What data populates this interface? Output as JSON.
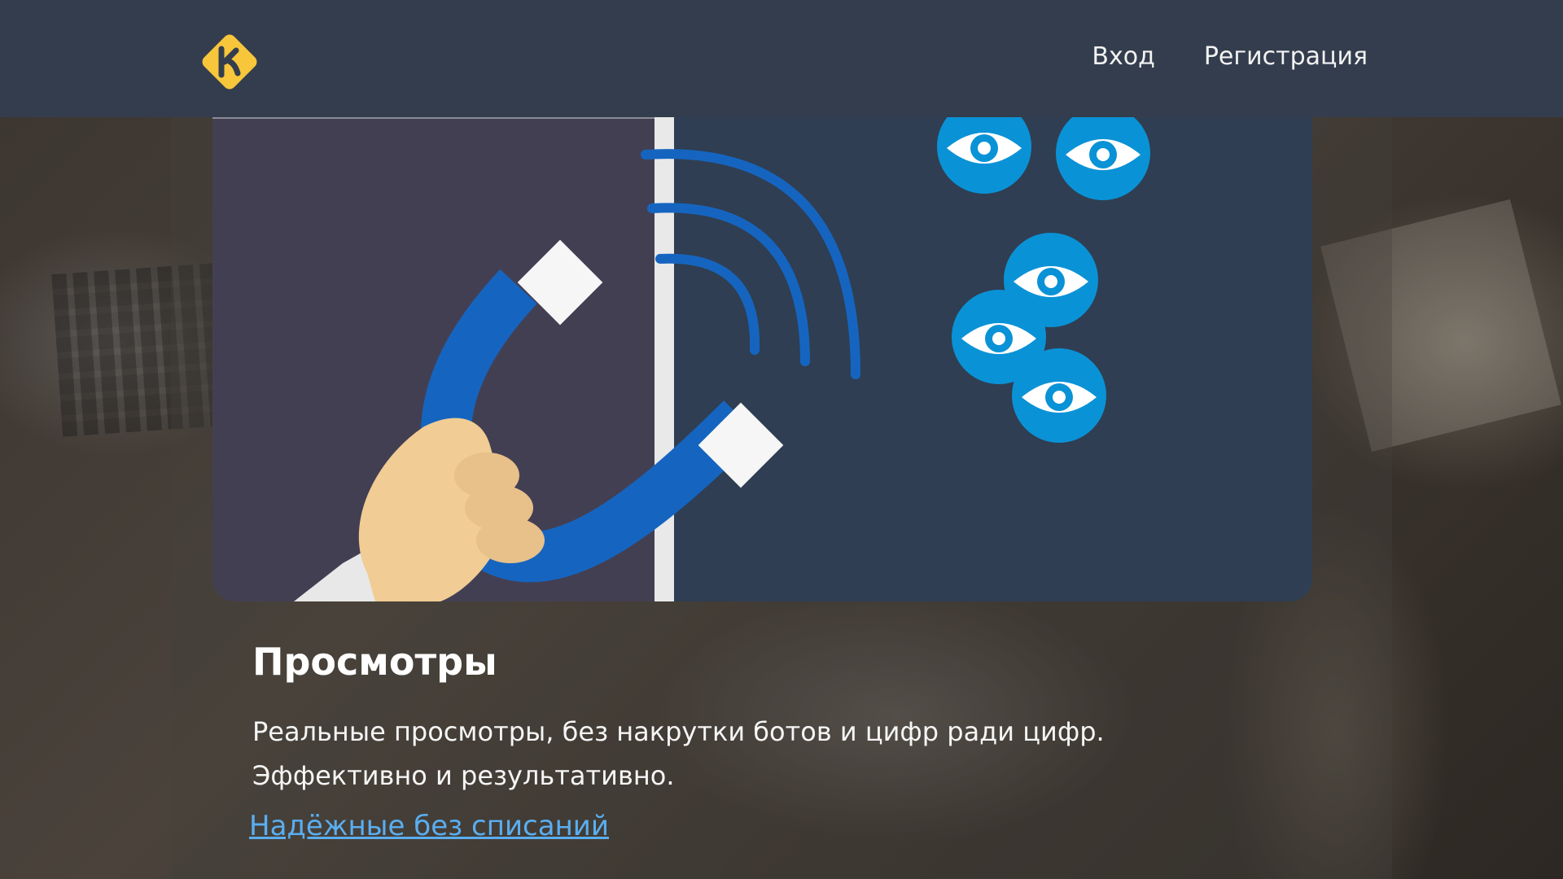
{
  "header": {
    "logo_icon": "k-logo-icon",
    "nav": [
      {
        "label": "Вход"
      },
      {
        "label": "Регистрация"
      }
    ]
  },
  "illustration": {
    "icons": [
      "magnet-icon",
      "hand-icon",
      "wifi-signal-icon",
      "eye-icon"
    ]
  },
  "feature": {
    "title": "Просмотры",
    "description_line1": "Реальные просмотры, без накрутки ботов и цифр ради цифр.",
    "description_line2": "Эффективно и результативно.",
    "link_label": "Надёжные без списаний"
  },
  "colors": {
    "header_bg": "#333d4d",
    "logo_yellow": "#f7c63b",
    "illustration_left": "#433f53",
    "illustration_right": "#2f3e52",
    "magnet_blue": "#1565c0",
    "eye_blue": "#0a92d6",
    "link_blue": "#5aaef0"
  }
}
